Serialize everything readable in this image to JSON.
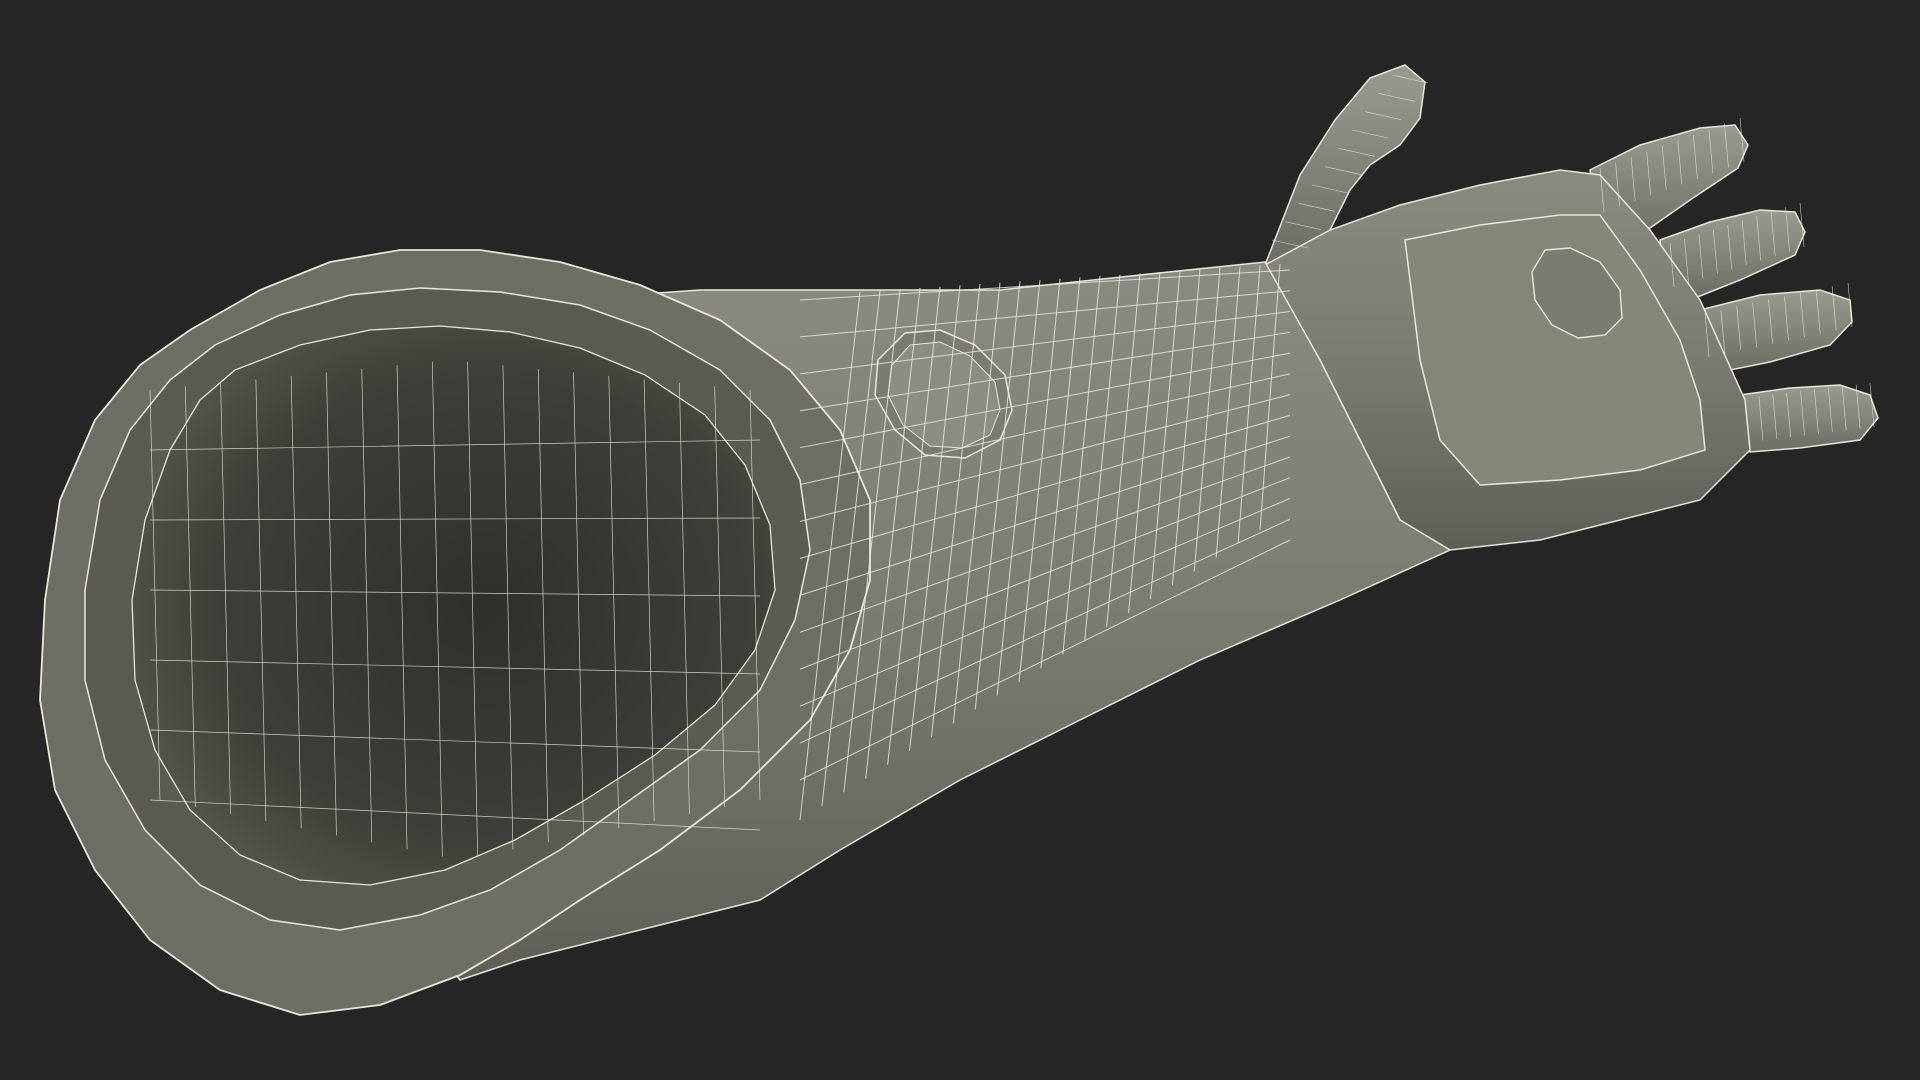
{
  "scene": {
    "subject": "prosthetic-forearm-wireframe",
    "background_color": "#262626",
    "mesh_fill_color": "#7b7b72",
    "mesh_dark_fill_color": "#3e3f38",
    "wire_color": "#e8e6da"
  }
}
